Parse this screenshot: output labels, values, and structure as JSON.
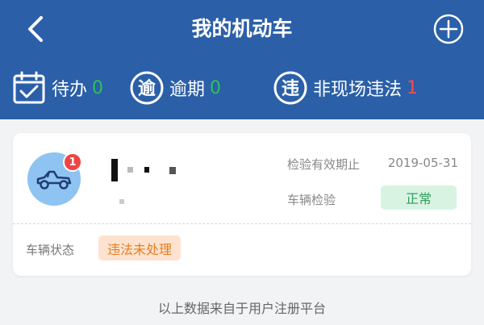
{
  "header": {
    "title": "我的机动车"
  },
  "stats": [
    {
      "label": "待办",
      "count": "0"
    },
    {
      "label": "逾期",
      "count": "0"
    },
    {
      "label": "非现场违法",
      "count": "1"
    }
  ],
  "icons": {
    "overdue_glyph": "逾",
    "violation_glyph": "违"
  },
  "vehicle": {
    "badge": "1",
    "expiry_label": "检验有效期止",
    "expiry_date": "2019-05-31",
    "inspection_label": "车辆检验",
    "inspection_status": "正常",
    "status_label": "车辆状态",
    "status_value": "违法未处理"
  },
  "footer": {
    "note": "以上数据来自于用户注册平台"
  },
  "colors": {
    "header_bg": "#2b5fa8",
    "count_ok": "#2fbf5f",
    "count_alert": "#ff4a4a",
    "normal_tag_bg": "#d9f3e3",
    "warning_tag_bg": "#fde3cf"
  }
}
